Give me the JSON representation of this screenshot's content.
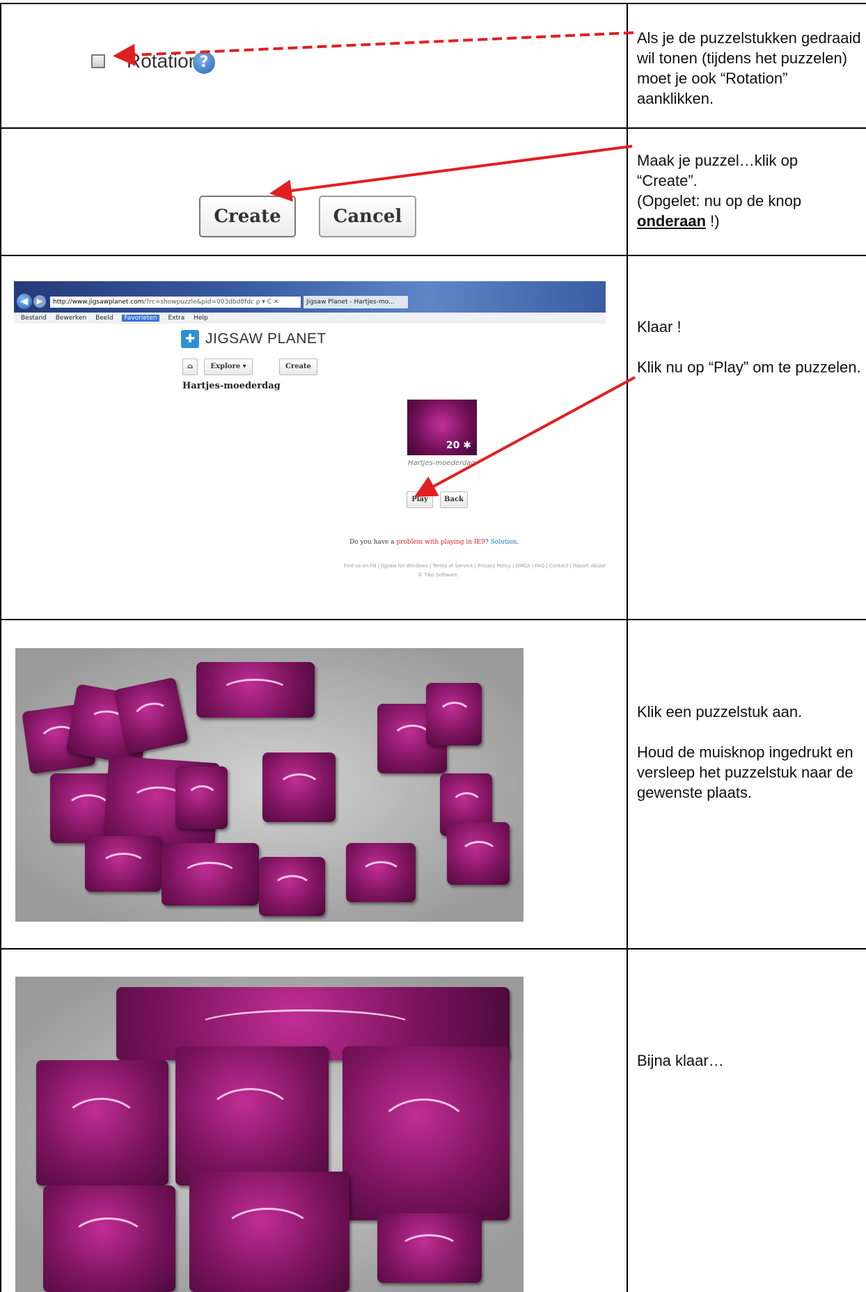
{
  "row1": {
    "checkbox_label": "Rotation",
    "help_symbol": "?",
    "note": "Als je de puzzelstukken gedraaid wil tonen (tijdens het puzzelen) moet je ook “Rotation” aanklikken."
  },
  "row2": {
    "create_label": "Create",
    "cancel_label": "Cancel",
    "note_line1": "Maak je puzzel…klik op “Create”.",
    "note_line2_pre": "(Opgelet: nu op de knop ",
    "note_line2_underlined": "onderaan",
    "note_line2_post": " !)"
  },
  "row3": {
    "browser": {
      "url_dark": "http://www.jigsawplanet.com",
      "url_rest": "/?rc=showpuzzle&pid=003dbd8fdc",
      "url_controls": "ρ ▾ C ✕",
      "tab_title": "Jigsaw Planet - Hartjes-mo...",
      "menu": [
        "Bestand",
        "Bewerken",
        "Beeld",
        "Favorieten",
        "Extra",
        "Help"
      ],
      "active_menu": "Favorieten"
    },
    "site": {
      "title": "JIGSAW PLANET",
      "home_label": "⌂",
      "explore_label": "Explore ▾",
      "create_label": "Create",
      "puzzle_title": "Hartjes-moederdag",
      "thumb_count": "20 ✱",
      "thumb_name": "Hartjes-moederdag",
      "play_label": "Play",
      "back_label": "Back",
      "ie9_pre": "Do you have a ",
      "ie9_red": "problem with playing in IE9",
      "ie9_mid": "? ",
      "ie9_link": "Solution",
      "ie9_end": ".",
      "footer_links": "Find us on FB | Jigsaw for Windows | Terms of Service | Privacy Policy | DMCA | FAQ | Contact | Report Abuse",
      "footer_copy": "© Tibo Software"
    },
    "note1": "Klaar !",
    "note2": "Klik nu op “Play” om te puzzelen."
  },
  "row4": {
    "note1": "Klik een puzzelstuk aan.",
    "note2": "Houd de muisknop ingedrukt en versleep het puzzelstuk naar de gewenste plaats."
  },
  "row5": {
    "note1": "Bijna klaar…"
  },
  "colors": {
    "arrow_red": "#e02020",
    "piece_magenta": "#8e1670",
    "background_gray": "#a8a8a8"
  }
}
